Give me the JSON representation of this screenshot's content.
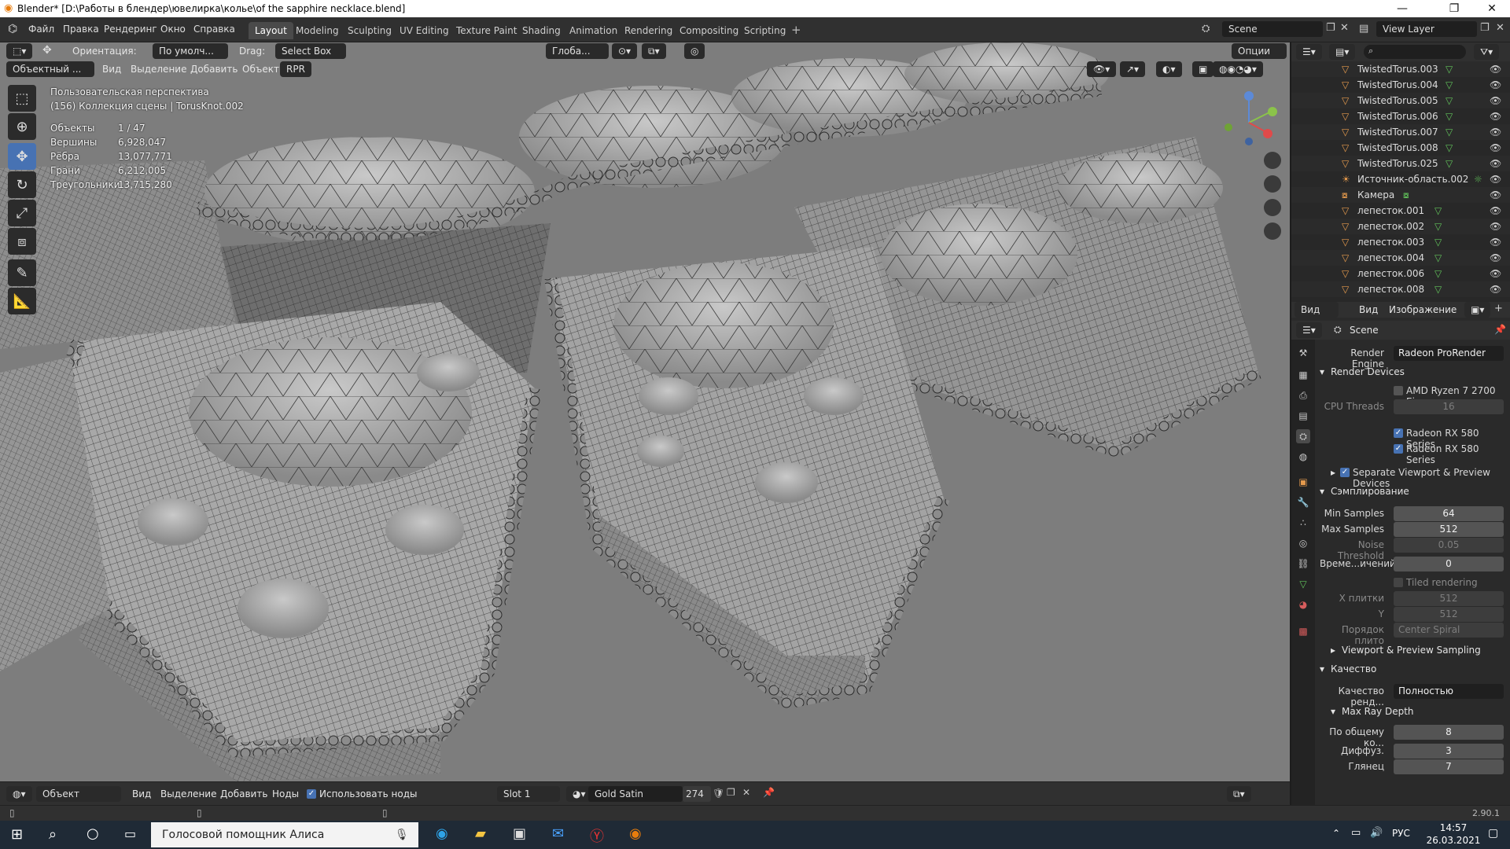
{
  "window": {
    "title": "Blender* [D:\\Работы в блендер\\ювелирка\\колье\\of the sapphire necklace.blend]"
  },
  "menu": [
    "Файл",
    "Правка",
    "Рендеринг",
    "Окно",
    "Справка"
  ],
  "workspaces": [
    "Layout",
    "Modeling",
    "Sculpting",
    "UV Editing",
    "Texture Paint",
    "Shading",
    "Animation",
    "Rendering",
    "Compositing",
    "Scripting"
  ],
  "scene": {
    "name": "Scene",
    "view_layer": "View Layer"
  },
  "viewport_header": {
    "orientation_label": "Ориентация:",
    "orientation_value": "По умолч...",
    "drag_label": "Drag:",
    "drag_value": "Select Box",
    "transform": "Глоба...",
    "options": "Опции",
    "mode": "Объектный ...",
    "menus": [
      "Вид",
      "Выделение",
      "Добавить",
      "Объект",
      "RPR"
    ]
  },
  "viewport_info": {
    "view": "Пользовательская перспектива",
    "collection": "(156) Коллекция сцены | TorusKnot.002",
    "stats": [
      {
        "label": "Объекты",
        "value": "1 / 47"
      },
      {
        "label": "Вершины",
        "value": "6,928,047"
      },
      {
        "label": "Рёбра",
        "value": "13,077,771"
      },
      {
        "label": "Грани",
        "value": "6,212,005"
      },
      {
        "label": "Треугольники",
        "value": "13,715,280"
      }
    ]
  },
  "outliner": {
    "rows": [
      "TwistedTorus.003",
      "TwistedTorus.004",
      "TwistedTorus.005",
      "TwistedTorus.006",
      "TwistedTorus.007",
      "TwistedTorus.008",
      "TwistedTorus.025",
      "Источник-область.002",
      "Камера",
      "лепесток.001",
      "лепесток.002",
      "лепесток.003",
      "лепесток.004",
      "лепесток.006",
      "лепесток.008"
    ]
  },
  "image_editor_header": {
    "view_btn": "Вид",
    "view_menu": "Вид",
    "image_menu": "Изображение"
  },
  "properties": {
    "context": "Scene",
    "render_engine_label": "Render Engine",
    "render_engine": "Radeon ProRender",
    "render_devices": "Render Devices",
    "cpu_device": "AMD Ryzen 7 2700 Ei...",
    "cpu_threads_label": "CPU Threads",
    "cpu_threads": "16",
    "gpu1": "Radeon RX 580 Series",
    "gpu2": "Radeon RX 580 Series",
    "separate": "Separate Viewport & Preview Devices",
    "sampling": "Сэмплирование",
    "min_samples_label": "Min Samples",
    "min_samples": "64",
    "max_samples_label": "Max Samples",
    "max_samples": "512",
    "noise_label": "Noise Threshold",
    "noise": "0.05",
    "time_label": "Време...ичений",
    "time": "0",
    "tiled": "Tiled rendering",
    "tile_x_label": "X плитки",
    "tile_x": "512",
    "tile_y_label": "Y",
    "tile_y": "512",
    "tile_order_label": "Порядок плито",
    "tile_order": "Center Spiral",
    "vp_sampling": "Viewport & Preview Sampling",
    "quality": "Качество",
    "quality_label": "Качество ренд...",
    "quality_value": "Полностью",
    "max_ray": "Max Ray Depth",
    "total_label": "По общему ко...",
    "total": "8",
    "diffuse_label": "Диффуз.",
    "diffuse": "3",
    "gloss_label": "Глянец",
    "gloss": "7"
  },
  "bottom_bar": {
    "mode": "Объект",
    "menus": [
      "Вид",
      "Выделение",
      "Добавить",
      "Ноды"
    ],
    "use_nodes": "Использовать ноды",
    "slot": "Slot 1",
    "material": "Gold Satin",
    "users": "274"
  },
  "status": {
    "version": "2.90.1"
  },
  "taskbar": {
    "search": "Голосовой помощник Алиса",
    "lang": "РУС",
    "time": "14:57",
    "date": "26.03.2021"
  }
}
